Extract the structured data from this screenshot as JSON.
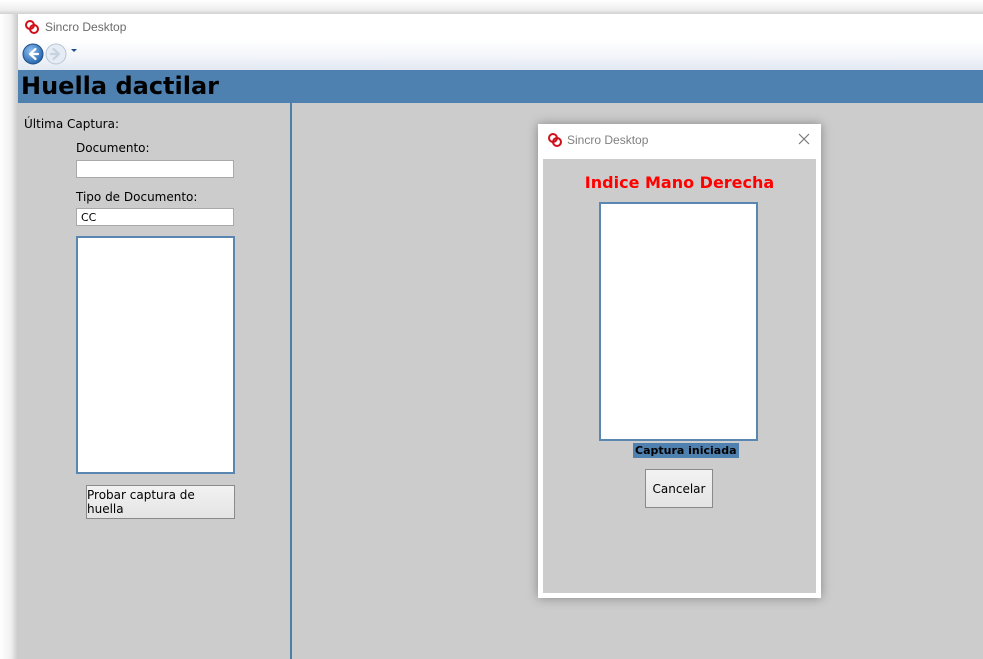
{
  "window": {
    "title": "Sincro Desktop"
  },
  "nav": {
    "back_icon": "arrow-left-icon",
    "forward_icon": "arrow-right-icon"
  },
  "header": {
    "title": "Huella dactilar",
    "bg_color": "#4f81b0"
  },
  "left_panel": {
    "last_capture_label": "Última Captura:",
    "document_label": "Documento:",
    "document_value": "",
    "doc_type_label": "Tipo de Documento:",
    "doc_type_value": "CC",
    "test_button_label": "Probar captura de huella"
  },
  "dialog": {
    "title": "Sincro Desktop",
    "finger_label": "Indice Mano Derecha",
    "finger_label_color": "#ff0000",
    "status_text": "Captura iniciada",
    "cancel_label": "Cancelar"
  }
}
